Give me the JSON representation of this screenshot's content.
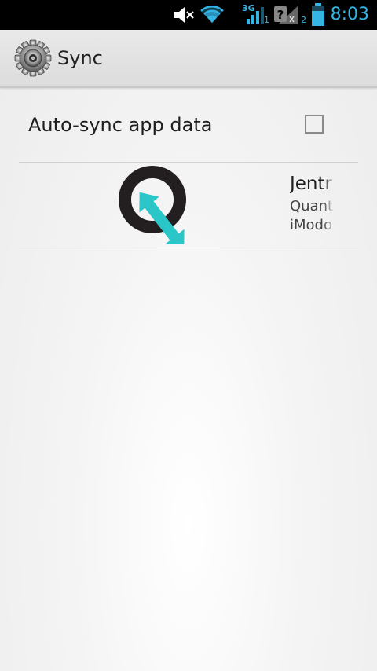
{
  "status_bar": {
    "time": "8:03",
    "sim1_label": "1",
    "sim2_label": "2",
    "network_label": "3G",
    "accent_color": "#33b5e5"
  },
  "action_bar": {
    "title": "Sync",
    "icon": "settings-gear-icon"
  },
  "auto_sync": {
    "label": "Auto-sync app data",
    "checked": false
  },
  "accounts": [
    {
      "name": "Jentr",
      "line1": "Quant",
      "line2": "iModo",
      "icon": "quantum-account-icon"
    }
  ]
}
